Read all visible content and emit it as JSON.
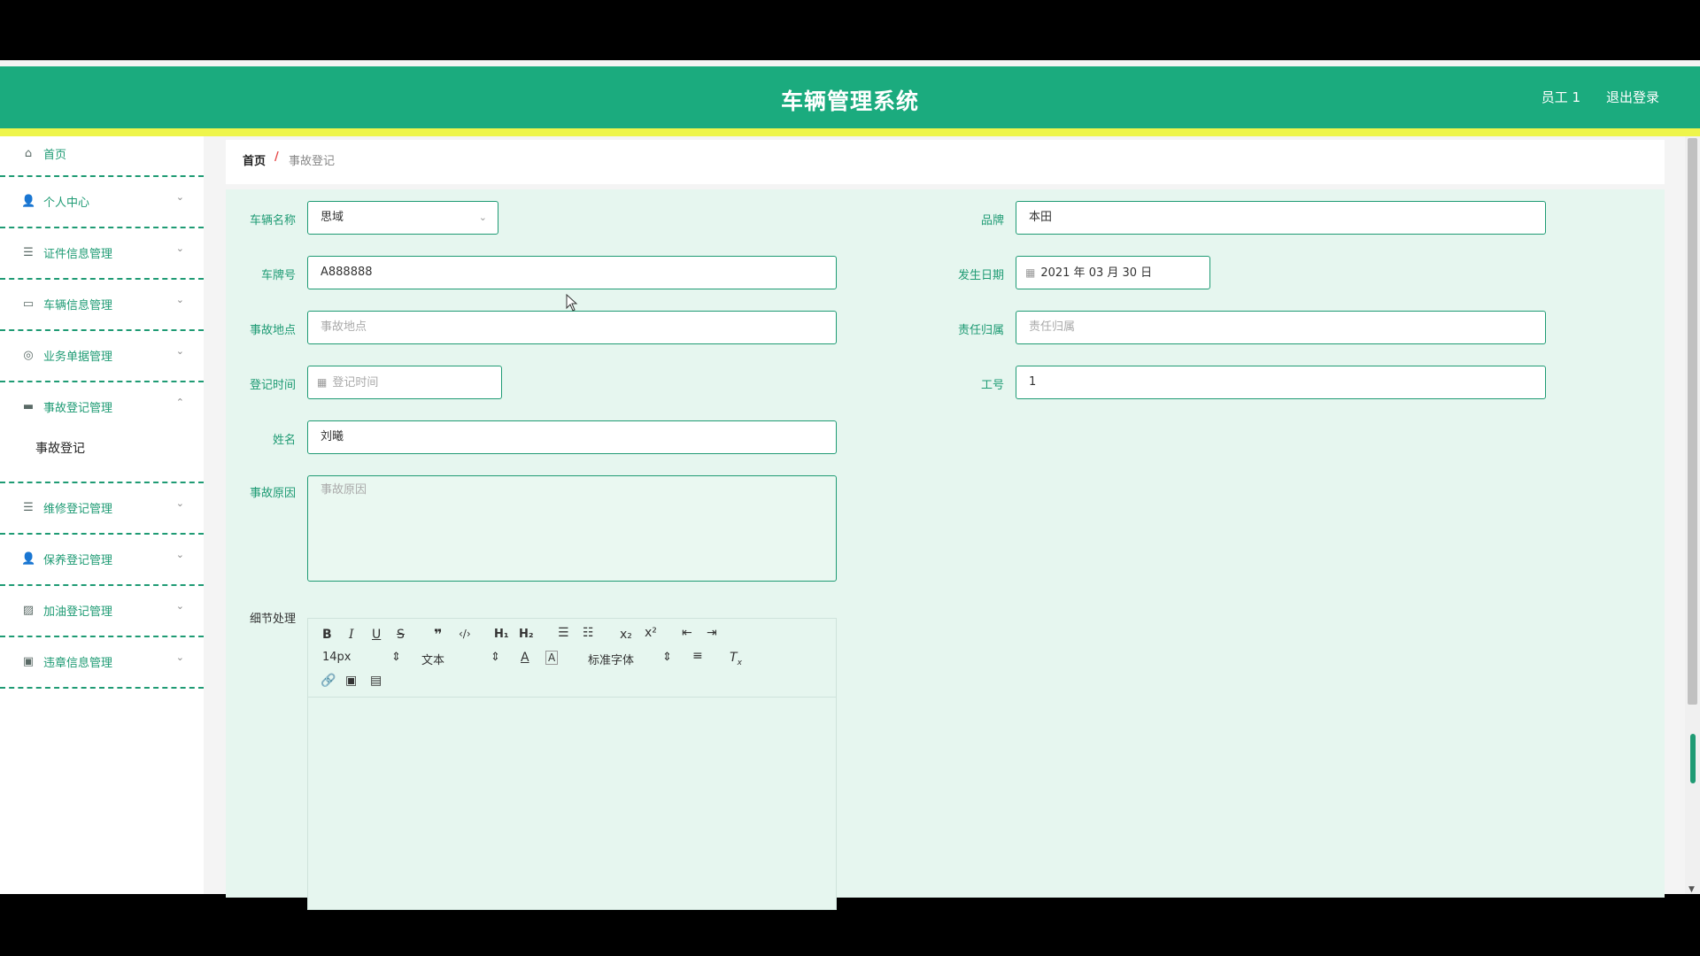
{
  "header": {
    "title": "车辆管理系统",
    "user": "员工 1",
    "logout": "退出登录"
  },
  "sidebar": {
    "items": [
      {
        "label": "首页",
        "icon": "home-icon"
      },
      {
        "label": "个人中心",
        "icon": "user-icon"
      },
      {
        "label": "证件信息管理",
        "icon": "list-icon"
      },
      {
        "label": "车辆信息管理",
        "icon": "chat-icon"
      },
      {
        "label": "业务单据管理",
        "icon": "compass-icon"
      },
      {
        "label": "事故登记管理",
        "icon": "message-icon"
      },
      {
        "label": "维修登记管理",
        "icon": "list-icon"
      },
      {
        "label": "保养登记管理",
        "icon": "user-icon"
      },
      {
        "label": "加油登记管理",
        "icon": "chart-icon"
      },
      {
        "label": "违章信息管理",
        "icon": "clipboard-icon"
      }
    ],
    "sub_item": "事故登记"
  },
  "breadcrumb": {
    "home": "首页",
    "separator": "/",
    "current": "事故登记"
  },
  "form": {
    "vehicle_name": {
      "label": "车辆名称",
      "value": "思域"
    },
    "brand": {
      "label": "品牌",
      "value": "本田"
    },
    "plate": {
      "label": "车牌号",
      "value": "A888888"
    },
    "date": {
      "label": "发生日期",
      "value": "2021 年 03 月 30 日"
    },
    "location": {
      "label": "事故地点",
      "placeholder": "事故地点"
    },
    "responsibility": {
      "label": "责任归属",
      "placeholder": "责任归属"
    },
    "reg_time": {
      "label": "登记时间",
      "placeholder": "登记时间"
    },
    "employee_no": {
      "label": "工号",
      "value": "1"
    },
    "name": {
      "label": "姓名",
      "value": "刘曦"
    },
    "cause": {
      "label": "事故原因",
      "placeholder": "事故原因"
    },
    "detail": {
      "label": "细节处理"
    }
  },
  "editor": {
    "font_size": "14px",
    "text_style": "文本",
    "font_family": "标准字体"
  },
  "colors": {
    "primary": "#1bab7e",
    "accent": "#eef54b",
    "form_bg": "#e6f6ef"
  }
}
